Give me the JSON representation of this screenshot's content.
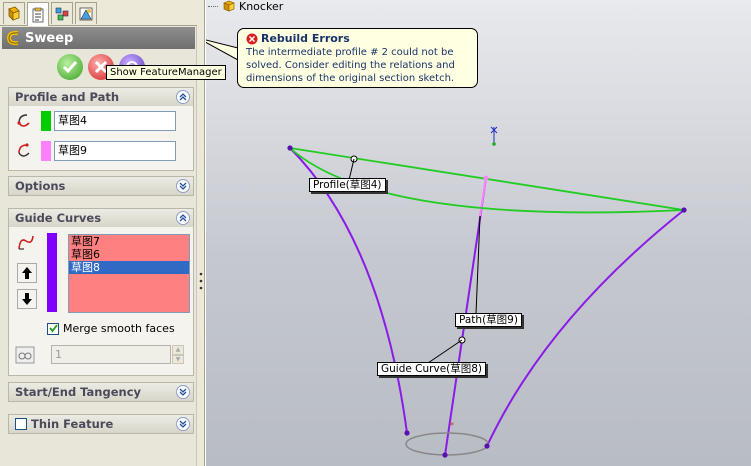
{
  "tree": {
    "knocker_label": "Knocker"
  },
  "tabs": [
    "featuremanager-tab",
    "propertymanager-tab",
    "configurationmanager-tab",
    "dimxpert-tab"
  ],
  "property_manager": {
    "title": "Sweep",
    "ok_tooltip": "Show FeatureManager",
    "profile_path": {
      "heading": "Profile and Path",
      "profile_value": "草图4",
      "path_value": "草图9",
      "profile_color": "#00cc00",
      "path_color": "#ff80ff"
    },
    "options": {
      "heading": "Options"
    },
    "guide_curves": {
      "heading": "Guide Curves",
      "items": [
        "草图7",
        "草图6",
        "草图8"
      ],
      "selected_index": 2,
      "list_color": "#ff8080",
      "swatch_color": "#8000ff",
      "merge_label": "Merge smooth faces",
      "merge_checked": true,
      "spin_value": "1"
    },
    "tangency": {
      "heading": "Start/End Tangency"
    },
    "thin": {
      "heading": "Thin Feature",
      "checked": false
    }
  },
  "error_balloon": {
    "title": "Rebuild Errors",
    "body": "The intermediate profile # 2 could not be solved. Consider editing the relations and dimensions of the original section sketch."
  },
  "callouts": {
    "profile": "Profile(草图4)",
    "path": "Path(草图9)",
    "guide": "Guide Curve(草图8)"
  },
  "colors": {
    "profile_curve": "#22cc22",
    "guide_curve": "#8a1be8",
    "path_curve": "#ff80ff"
  }
}
